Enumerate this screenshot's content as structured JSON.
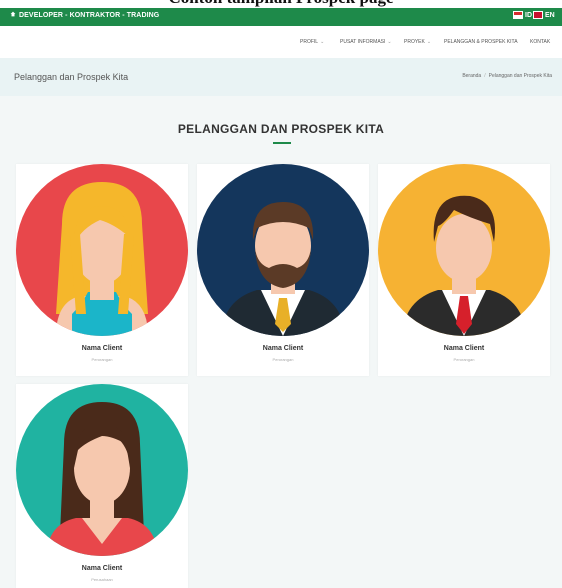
{
  "caption": "Contoh tampilan Prospek page",
  "topbar": {
    "brand": "DEVELOPER - KONTRAKTOR - TRADING",
    "lang_id": "ID",
    "lang_en": "EN"
  },
  "nav": {
    "items": [
      "PROFIL",
      "PUSAT INFORMASI",
      "PROYEK",
      "PELANGGAN & PROSPEK KITA",
      "KONTAK"
    ]
  },
  "page": {
    "title": "Pelanggan dan Prospek Kita",
    "breadcrumb": [
      "Beranda",
      "Pelanggan dan Prospek Kita"
    ]
  },
  "section": {
    "heading": "PELANGGAN DAN PROSPEK KITA"
  },
  "clients": [
    {
      "name": "Nama Client",
      "role": "Perorangan",
      "avatar_color": "#e8474b"
    },
    {
      "name": "Nama Client",
      "role": "Perorangan",
      "avatar_color": "#14365c"
    },
    {
      "name": "Nama Client",
      "role": "Perorangan",
      "avatar_color": "#f6b233"
    },
    {
      "name": "Nama Client",
      "role": "Perusahaan",
      "avatar_color": "#20b3a1"
    }
  ],
  "colors": {
    "brand_green": "#1e8a4a",
    "skin": "#f6c8ae"
  }
}
